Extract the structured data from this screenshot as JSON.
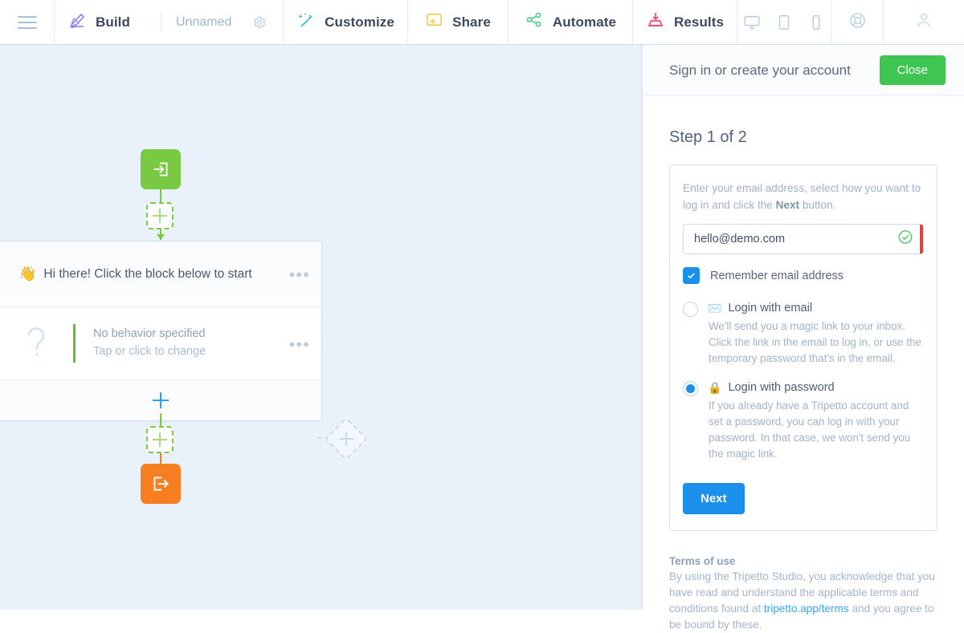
{
  "topbar": {
    "menu_icon": "hamburger-icon",
    "build": {
      "label": "Build",
      "icon": "build-pen-icon",
      "name": "Unnamed",
      "gear_icon": "gear-icon"
    },
    "customize": {
      "label": "Customize",
      "icon": "magic-wand-icon"
    },
    "share": {
      "label": "Share",
      "icon": "screencast-icon"
    },
    "automate": {
      "label": "Automate",
      "icon": "nodes-icon"
    },
    "results": {
      "label": "Results",
      "icon": "inbox-download-icon"
    },
    "devices": [
      "desktop-icon",
      "tablet-icon",
      "phone-icon"
    ],
    "help_icon": "life-ring-icon",
    "account_icon": "user-avatar-icon"
  },
  "canvas": {
    "start_block": {
      "icon": "enter-arrow-icon",
      "color": "#7ac943"
    },
    "end_block": {
      "icon": "exit-arrow-icon",
      "color": "#f77f21"
    },
    "card": {
      "header": {
        "emoji": "👋",
        "text": "Hi there! Click the block below to start",
        "menu": "●●●"
      },
      "body": {
        "icon": "question-mark-icon",
        "title": "No behavior specified",
        "subtitle": "Tap or click to change",
        "menu": "●●●"
      },
      "footer_add_icon": "plus-icon"
    },
    "branch_add_icon": "plus-diamond-icon"
  },
  "panel": {
    "title": "Sign in or create your account",
    "close_label": "Close",
    "step_title": "Step 1 of 2",
    "form": {
      "intro_before": "Enter your email address, select how you want to log in and click the ",
      "intro_bold": "Next",
      "intro_after": " button.",
      "email_value": "hello@demo.com",
      "email_placeholder": "Enter your email address",
      "email_valid_icon": "check-circle-icon",
      "remember_label": "Remember email address",
      "remember_checked": true,
      "options": [
        {
          "emoji": "✉️",
          "label": "Login with email",
          "description": "We'll send you a magic link to your inbox. Click the link in the email to log in, or use the temporary password that's in the email.",
          "selected": false
        },
        {
          "emoji": "🔒",
          "label": "Login with password",
          "description": "If you already have a Tripetto account and set a password, you can log in with your password. In that case, we won't send you the magic link.",
          "selected": true
        }
      ],
      "next_label": "Next"
    },
    "terms": {
      "title": "Terms of use",
      "text_before": "By using the Tripetto Studio, you acknowledge that you have read and understand the applicable terms and conditions found at ",
      "link": "tripetto.app/terms",
      "text_after": " and you agree to be bound by these."
    }
  },
  "colors": {
    "accent_blue": "#1a8fec",
    "green": "#3fc552",
    "start_green": "#7ac943",
    "end_orange": "#f77f21",
    "error_red": "#f13b3b",
    "canvas_bg": "#e9f1fb"
  }
}
